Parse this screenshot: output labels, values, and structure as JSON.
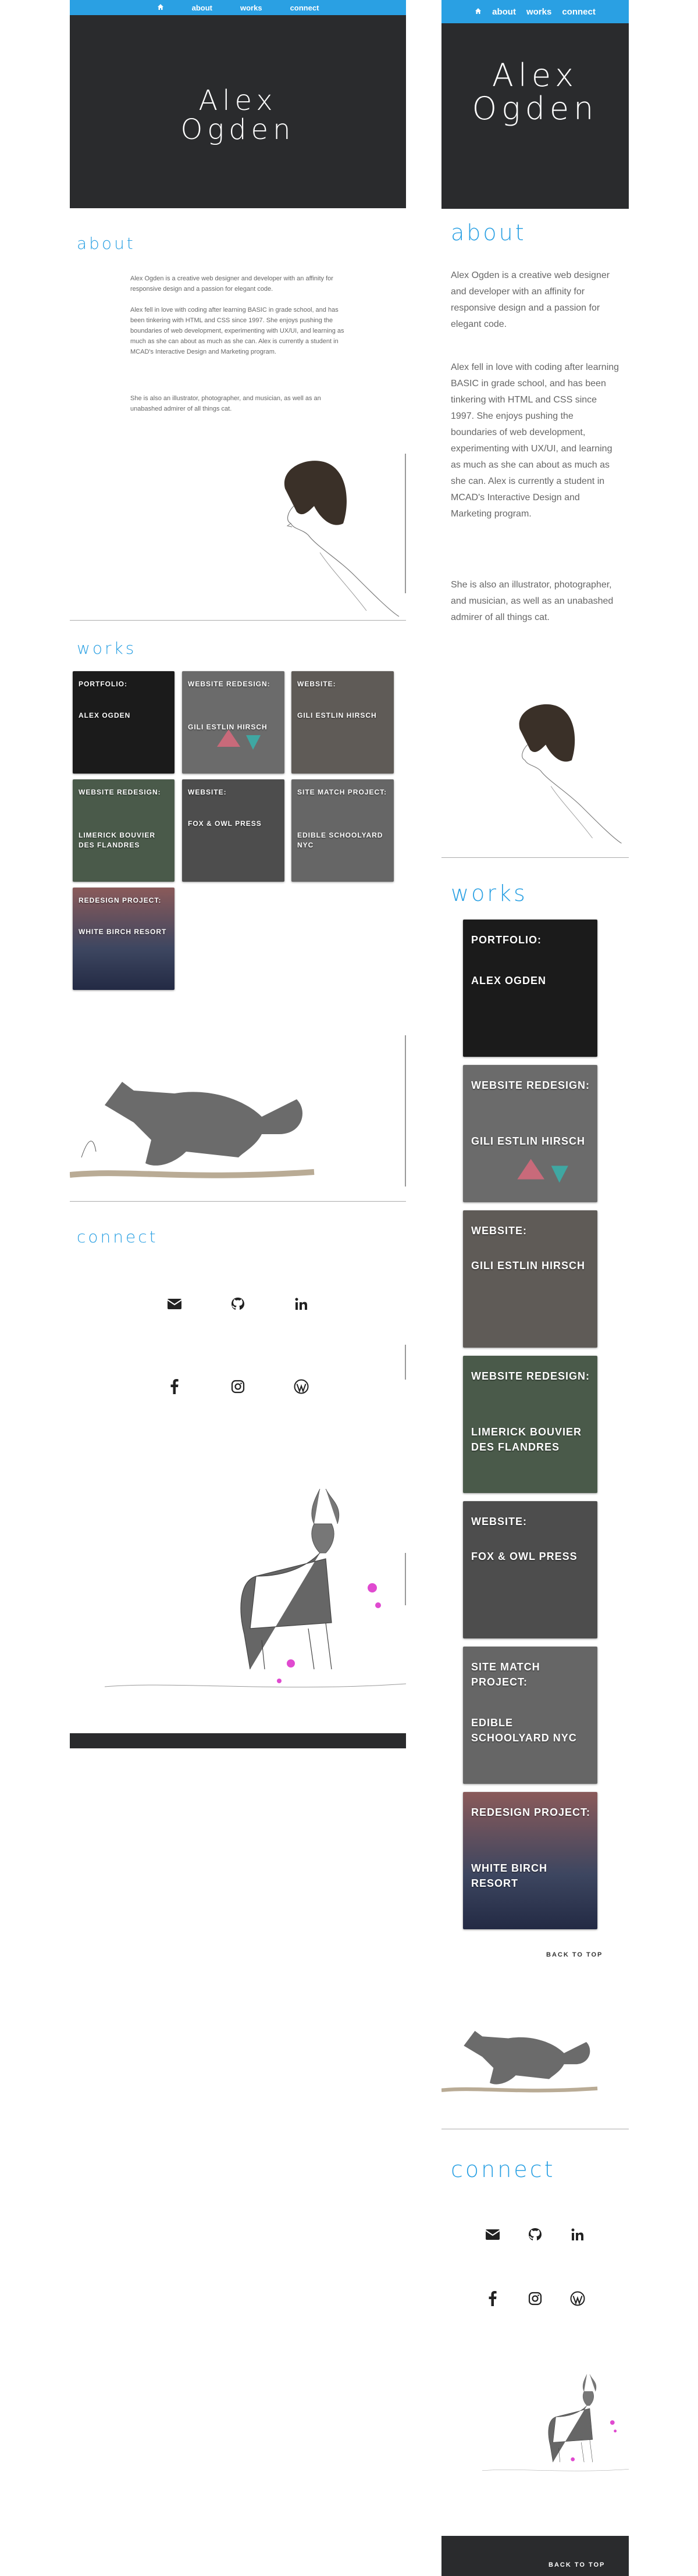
{
  "nav": {
    "home_icon": "home-icon",
    "about": "about",
    "works": "works",
    "connect": "connect"
  },
  "hero": {
    "first": "Alex",
    "last": "Ogden"
  },
  "about": {
    "title": "about",
    "p1": "Alex Ogden is a creative web designer and developer with an affinity for responsive design and a passion for elegant code.",
    "p2": "Alex fell in love with coding after learning BASIC in grade school, and has been tinkering with HTML and CSS since 1997. She enjoys pushing the boundaries of web development, experimenting with UX/UI, and learning as much as she can about as much as she can. Alex is currently a student in MCAD's Interactive Design and Marketing program.",
    "p3": "She is also an illustrator, photographer, and musician, as well as an unabashed admirer of all things cat."
  },
  "works": {
    "title": "works",
    "tiles": [
      {
        "label1": "Portfolio:",
        "label2": "Alex Ogden",
        "color": "#1b1b1b"
      },
      {
        "label1": "Website Redesign:",
        "label2": "Gili Estlin Hirsch",
        "color": "#6b6b6b"
      },
      {
        "label1": "Website:",
        "label2": "Gili Estlin Hirsch",
        "color": "#5f5b57"
      },
      {
        "label1": "Website Redesign:",
        "label2": "Limerick Bouvier des Flandres",
        "color": "#4a5a4a"
      },
      {
        "label1": "Website:",
        "label2": "Fox & Owl Press",
        "color": "#4d4d4d"
      },
      {
        "label1": "Site Match Project:",
        "label2": "Edible Schoolyard NYC",
        "color": "#666"
      },
      {
        "label1": "Redesign Project:",
        "label2": "White Birch Resort",
        "color": "#3d4660"
      }
    ],
    "back_to_top": "BACK TO TOP"
  },
  "connect": {
    "title": "connect",
    "icons": [
      "envelope-icon",
      "github-icon",
      "linkedin-icon",
      "facebook-icon",
      "instagram-icon",
      "wordpress-icon"
    ]
  },
  "footer": {
    "back_to_top": "BACK TO TOP"
  },
  "colors": {
    "accent": "#2aa0e3",
    "dark": "#2a2b2d"
  }
}
